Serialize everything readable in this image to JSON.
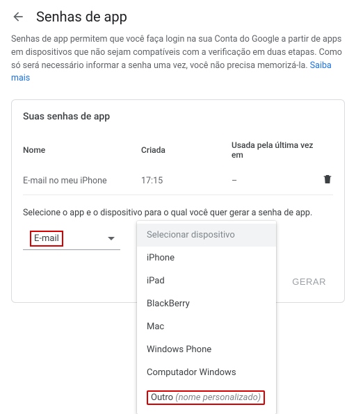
{
  "header": {
    "title": "Senhas de app"
  },
  "description": {
    "text": "Senhas de app permitem que você faça login na sua Conta do Google a partir de apps em dispositivos que não sejam compatíveis com a verificação em duas etapas. Como só será necessário informar a senha uma vez, você não precisa memorizá-la. ",
    "link_text": "Saiba mais"
  },
  "card": {
    "title": "Suas senhas de app",
    "columns": {
      "name": "Nome",
      "created": "Criada",
      "last_used": "Usada pela última vez em"
    },
    "rows": [
      {
        "name": "E-mail no meu iPhone",
        "created": "17:15",
        "last_used": "–"
      }
    ],
    "select_hint": "Selecione o app e o dispositivo para o qual você quer gerar a senha de app.",
    "app_dropdown": {
      "selected": "E-mail"
    },
    "device_menu": {
      "placeholder": "Selecionar dispositivo",
      "items": [
        "iPhone",
        "iPad",
        "BlackBerry",
        "Mac",
        "Windows Phone",
        "Computador Windows"
      ],
      "other_prefix": "Outro ",
      "other_suffix": "(nome personalizado)"
    },
    "generate_label": "GERAR"
  }
}
